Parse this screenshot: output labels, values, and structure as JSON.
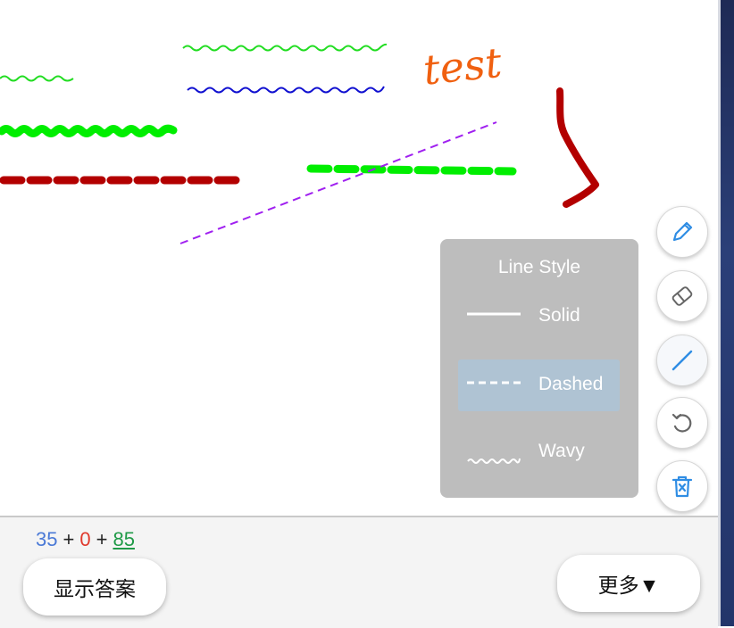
{
  "canvas": {
    "handwritten_text": "test",
    "stroke_colors": {
      "light_green": "#22dd22",
      "blue": "#1010d0",
      "bright_green": "#00ee00",
      "dark_red": "#b30000",
      "purple_dashed": "#a020f0",
      "orange_text": "#f06010"
    }
  },
  "toolbar": {
    "tools": [
      {
        "name": "pen",
        "icon": "pencil-icon",
        "active": false
      },
      {
        "name": "eraser",
        "icon": "eraser-icon",
        "active": false
      },
      {
        "name": "line",
        "icon": "line-icon",
        "active": true
      },
      {
        "name": "undo",
        "icon": "undo-icon",
        "active": false
      },
      {
        "name": "clear",
        "icon": "trash-icon",
        "active": false
      }
    ],
    "accent_color": "#2f8de4"
  },
  "line_style_panel": {
    "title": "Line Style",
    "options": [
      {
        "label": "Solid",
        "selected": false
      },
      {
        "label": "Dashed",
        "selected": true
      },
      {
        "label": "Wavy",
        "selected": false
      }
    ]
  },
  "bottom_bar": {
    "score": {
      "a": "35",
      "op1": "+",
      "b": "0",
      "op2": "+",
      "c": "85"
    },
    "show_answer_label": "显示答案",
    "more_label": "更多▼"
  }
}
